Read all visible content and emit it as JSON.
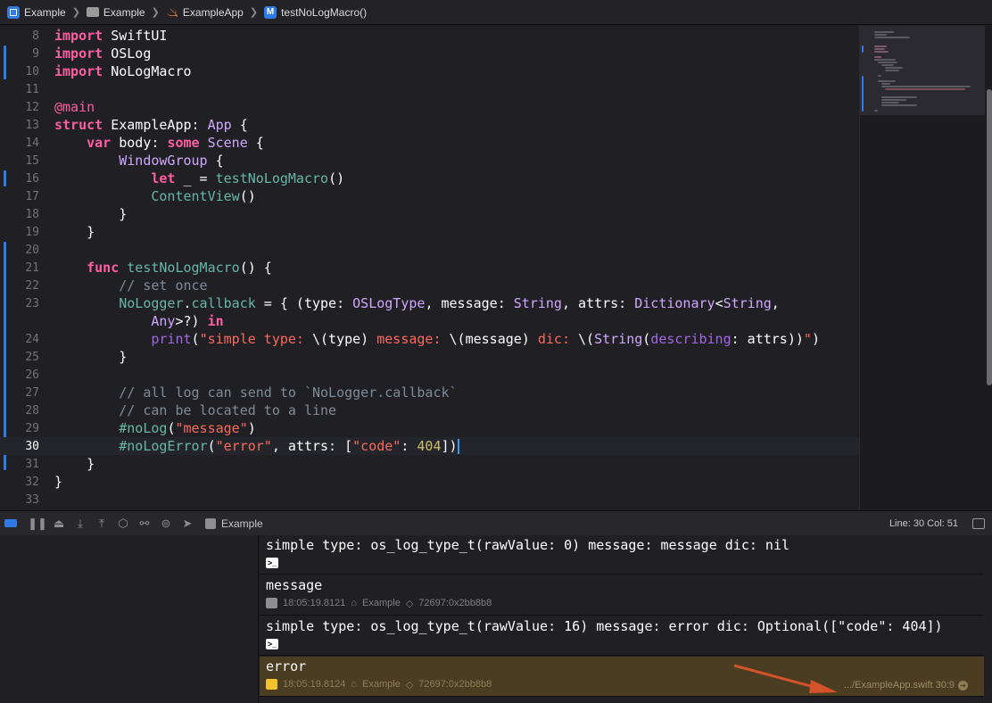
{
  "breadcrumb": [
    "Example",
    "Example",
    "ExampleApp",
    "testNoLogMacro()"
  ],
  "editor": {
    "lines": [
      {
        "n": "8"
      },
      {
        "n": "9"
      },
      {
        "n": "10"
      },
      {
        "n": "11"
      },
      {
        "n": "12"
      },
      {
        "n": "13"
      },
      {
        "n": "14"
      },
      {
        "n": "15"
      },
      {
        "n": "16"
      },
      {
        "n": "17"
      },
      {
        "n": "18"
      },
      {
        "n": "19"
      },
      {
        "n": "20"
      },
      {
        "n": "21"
      },
      {
        "n": "22"
      },
      {
        "n": "23"
      },
      {
        "n": ""
      },
      {
        "n": "24"
      },
      {
        "n": "25"
      },
      {
        "n": "26"
      },
      {
        "n": "27"
      },
      {
        "n": "28"
      },
      {
        "n": "29"
      },
      {
        "n": "30"
      },
      {
        "n": "31"
      },
      {
        "n": "32"
      },
      {
        "n": "33"
      }
    ],
    "current_line": "30"
  },
  "debug_bar": {
    "target": "Example",
    "position": "Line: 30  Col: 51"
  },
  "console": {
    "entries": [
      {
        "message": "simple type: os_log_type_t(rawValue: 0) message: message dic: nil",
        "meta": ""
      },
      {
        "message": "message",
        "time": "18:05:19.8121",
        "process": "Example",
        "pid": "72697:0x2bb8b8"
      },
      {
        "message": "simple type: os_log_type_t(rawValue: 16) message: error dic: Optional([\"code\": 404])",
        "meta": ""
      },
      {
        "message": "error",
        "time": "18:05:19.8124",
        "process": "Example",
        "pid": "72697:0x2bb8b8",
        "source": ".../ExampleApp.swift 30:9"
      }
    ]
  },
  "colors": {
    "accent": "#2f7ae5",
    "error_row": "#4b3d21",
    "keyword": "#fc5fa3",
    "string": "#fc6a5d"
  }
}
